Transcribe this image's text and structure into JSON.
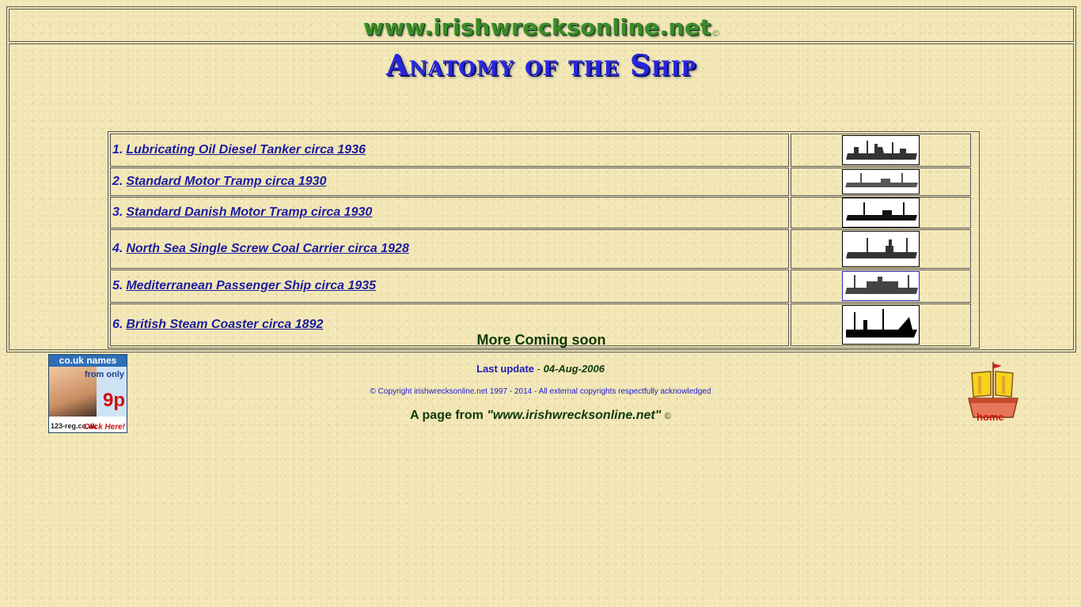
{
  "header": {
    "site_logo": "www.irishwrecksonline.net",
    "copyright_symbol": "©"
  },
  "page_title": "Anatomy of the Ship",
  "ships": [
    {
      "number": "1.",
      "name": "Lubricating Oil Diesel Tanker circa 1936"
    },
    {
      "number": "2.",
      "name": "Standard Motor Tramp circa 1930"
    },
    {
      "number": "3.",
      "name": "Standard Danish Motor Tramp circa 1930"
    },
    {
      "number": "4.",
      "name": "North Sea Single Screw Coal Carrier circa 1928"
    },
    {
      "number": "5.",
      "name": "Mediterranean Passenger Ship circa 1935"
    },
    {
      "number": "6.",
      "name": "British Steam Coaster circa 1892"
    }
  ],
  "more_coming": "More Coming soon",
  "ad": {
    "top": "co.uk names",
    "from": "from only",
    "price": "9p",
    "brand": "123-reg.co.uk",
    "click": "Click Here!"
  },
  "footer": {
    "last_update_label": "Last update",
    "last_update_sep": "-",
    "last_update_date": "04-Aug-2006",
    "copyright": "© Copyright irishwrecksonline.net 1997 - 2014 - All external copyrights respectfully acknowledged",
    "page_from_prefix": "A page from ",
    "page_from_site": "\"www.irishwrecksonline.net\"",
    "page_from_copy": "©",
    "home_label": "home"
  },
  "colors": {
    "background": "#f2e6b4",
    "link": "#1c1ca0",
    "title": "#2626e0",
    "dark_green": "#0d3a08"
  }
}
